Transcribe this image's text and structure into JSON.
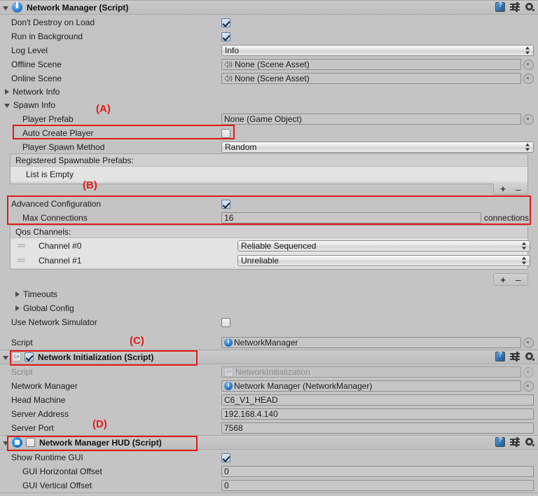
{
  "window": {
    "background_color": "#c4c4c4",
    "accent_color": "#e01b1b"
  },
  "header_icons": {
    "help": "help-book-icon",
    "preset": "preset-sliders-icon",
    "settings": "gear-icon"
  },
  "components": [
    {
      "id": "network-manager",
      "title": "Network Manager (Script)",
      "icon": "unity-networkmanager-icon",
      "expanded": true,
      "properties": [
        {
          "label": "Don't Destroy on Load",
          "type": "checkbox",
          "value": true
        },
        {
          "label": "Run in Background",
          "type": "checkbox",
          "value": true
        },
        {
          "label": "Log Level",
          "type": "popup",
          "value": "Info"
        },
        {
          "label": "Offline Scene",
          "type": "object",
          "value": "None (Scene Asset)",
          "icon": "scene-asset-icon"
        },
        {
          "label": "Online Scene",
          "type": "object",
          "value": "None (Scene Asset)",
          "icon": "scene-asset-icon"
        }
      ],
      "foldouts": {
        "network_info": "Network Info",
        "spawn_info": "Spawn Info",
        "timeouts": "Timeouts",
        "global_config": "Global Config"
      },
      "spawn_info": [
        {
          "label": "Player Prefab",
          "type": "object",
          "value": "None (Game Object)"
        },
        {
          "label": "Auto Create Player",
          "type": "checkbox",
          "value": false
        },
        {
          "label": "Player Spawn Method",
          "type": "popup",
          "value": "Random"
        }
      ],
      "spawnable_prefabs": {
        "header": "Registered Spawnable Prefabs:",
        "empty_text": "List is Empty",
        "add_label": "+",
        "remove_label": "–"
      },
      "advanced": [
        {
          "label": "Advanced Configuration",
          "type": "checkbox",
          "value": true
        },
        {
          "label": "Max Connections",
          "type": "number",
          "value": "16",
          "suffix": "connections"
        }
      ],
      "qos": {
        "header": "Qos Channels:",
        "channels": [
          {
            "label": "Channel #0",
            "value": "Reliable Sequenced"
          },
          {
            "label": "Channel #1",
            "value": "Unreliable"
          }
        ],
        "add_label": "+",
        "remove_label": "–"
      },
      "simulator": {
        "label": "Use Network Simulator",
        "type": "checkbox",
        "value": false
      },
      "script": {
        "label": "Script",
        "value": "NetworkManager",
        "icon": "unity-script-icon"
      }
    },
    {
      "id": "network-initialization",
      "title": "Network Initialization (Script)",
      "icon": "csharp-script-icon",
      "enabled": true,
      "expanded": true,
      "properties": [
        {
          "label": "Script",
          "type": "object",
          "value": "NetworkInitialization",
          "disabled": true,
          "icon": "csharp-script-icon"
        },
        {
          "label": "Network Manager",
          "type": "object",
          "value": "Network Manager (NetworkManager)",
          "icon": "unity-script-icon"
        },
        {
          "label": "Head Machine",
          "type": "text",
          "value": "C6_V1_HEAD"
        },
        {
          "label": "Server Address",
          "type": "text",
          "value": "192.168.4.140"
        },
        {
          "label": "Server Port",
          "type": "text",
          "value": "7568"
        }
      ]
    },
    {
      "id": "network-manager-hud",
      "title": "Network Manager HUD (Script)",
      "icon": "hud-script-icon",
      "enabled": false,
      "expanded": true,
      "properties": [
        {
          "label": "Show Runtime GUI",
          "type": "checkbox",
          "value": true
        },
        {
          "label": "GUI Horizontal Offset",
          "type": "text",
          "value": "0"
        },
        {
          "label": "GUI Vertical Offset",
          "type": "text",
          "value": "0"
        }
      ]
    }
  ],
  "annotations": [
    {
      "id": "A",
      "label": "(A)"
    },
    {
      "id": "B",
      "label": "(B)"
    },
    {
      "id": "C",
      "label": "(C)"
    },
    {
      "id": "D",
      "label": "(D)"
    }
  ]
}
